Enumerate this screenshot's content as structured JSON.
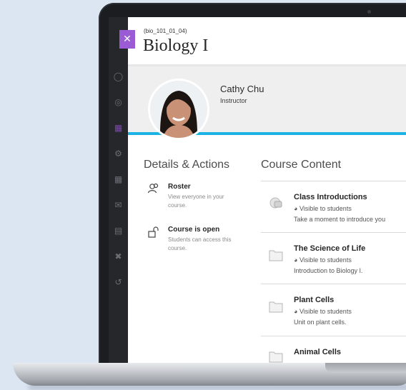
{
  "course": {
    "id": "(bio_101_01_04)",
    "title": "Biology I"
  },
  "instructor": {
    "name": "Cathy Chu",
    "role": "Instructor"
  },
  "details": {
    "heading": "Details & Actions",
    "items": [
      {
        "title": "Roster",
        "description": "View everyone in your course."
      },
      {
        "title": "Course is open",
        "description": "Students can access this course."
      }
    ]
  },
  "content": {
    "heading": "Course Content",
    "items": [
      {
        "title": "Class Introductions",
        "visibility": "Visible to students",
        "description": "Take a moment to introduce you"
      },
      {
        "title": "The Science of Life",
        "visibility": "Visible to students",
        "description": "Introduction to Biology I."
      },
      {
        "title": "Plant Cells",
        "visibility": "Visible to students",
        "description": "Unit on plant cells."
      },
      {
        "title": "Animal Cells",
        "visibility": "",
        "description": ""
      }
    ]
  },
  "sidebar_icons": [
    "user-icon",
    "globe-icon",
    "calendar-icon",
    "gear-icon",
    "grades-icon",
    "mail-icon",
    "document-icon",
    "tools-icon",
    "logout-icon"
  ],
  "colors": {
    "accent": "#1bb3e4",
    "close": "#9a5bd4"
  }
}
